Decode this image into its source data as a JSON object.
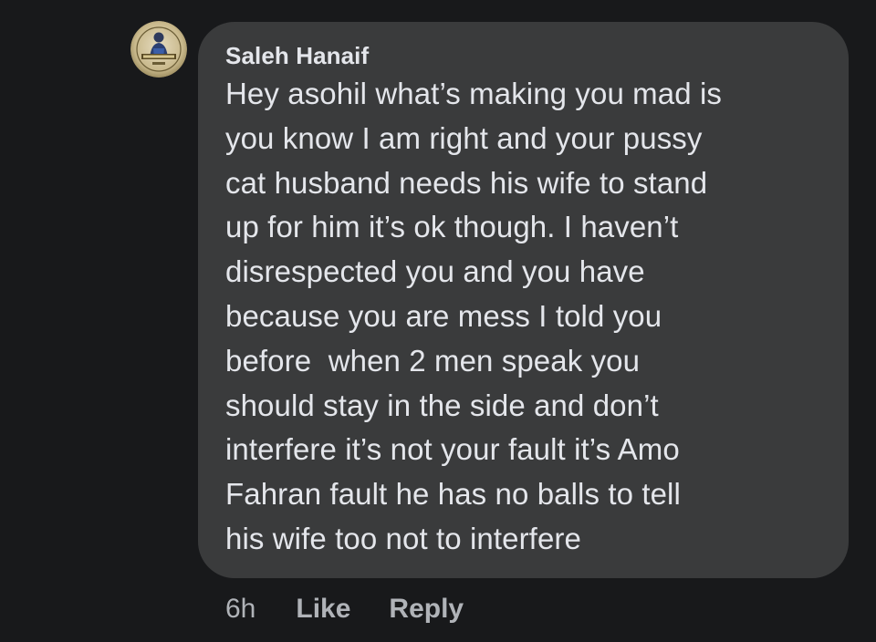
{
  "comment": {
    "author": "Saleh Hanaif",
    "lines": [
      "Hey asohil what’s making you mad is",
      "you know I am right and your pussy",
      "cat husband needs his wife to stand",
      "up for him it’s ok though. I haven’t",
      "disrespected you and you have",
      "because you are mess I told you",
      "before  when 2 men speak you",
      "should stay in the side and don’t",
      "interfere it’s not your fault it’s Amo",
      "Fahran fault he has no balls to tell",
      "his wife too not to interfere"
    ],
    "timestamp": "6h",
    "like_label": "Like",
    "reply_label": "Reply",
    "avatar_icon": "profile-avatar-icon"
  },
  "colors": {
    "background": "#18191b",
    "bubble": "#3a3b3c",
    "text": "#e4e6eb",
    "secondary_text": "#b0b3b8"
  }
}
